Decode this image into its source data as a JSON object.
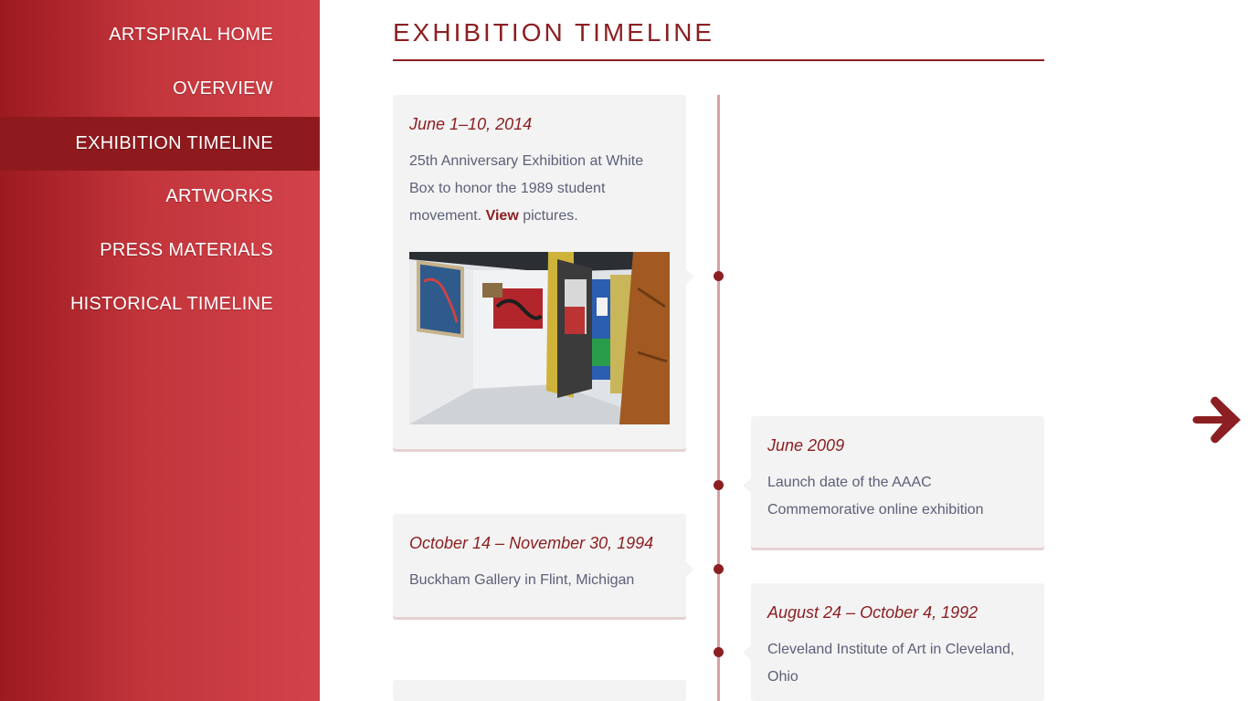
{
  "nav": {
    "items": [
      {
        "label": "ARTSPIRAL HOME"
      },
      {
        "label": "OVERVIEW"
      },
      {
        "label": "EXHIBITION TIMELINE"
      },
      {
        "label": "ARTWORKS"
      },
      {
        "label": "PRESS MATERIALS"
      },
      {
        "label": "HISTORICAL TIMELINE"
      }
    ],
    "active_index": 2
  },
  "page": {
    "title": "EXHIBITION TIMELINE"
  },
  "timeline": [
    {
      "date": "June 1–10, 2014",
      "text_before": "25th Anniversary Exhibition at White Box to honor the 1989 student movement. ",
      "link_label": "View",
      "text_after": " pictures.",
      "has_photo": true
    },
    {
      "date": "June 2009",
      "text": "Launch date of the AAAC Commemorative online exhibition"
    },
    {
      "date": "October 14 – November 30, 1994",
      "text": "Buckham Gallery in Flint, Michigan"
    },
    {
      "date": "August 24 – October 4, 1992",
      "text": "Cleveland Institute of Art in Cleveland, Ohio"
    }
  ],
  "icons": {
    "next": "arrow-right-icon"
  },
  "colors": {
    "accent": "#8c1f22",
    "sidebar_gradient_start": "#9c1a20",
    "sidebar_gradient_end": "#d2424a",
    "card_background": "#f3f3f3",
    "body_text": "#5c5f78"
  }
}
